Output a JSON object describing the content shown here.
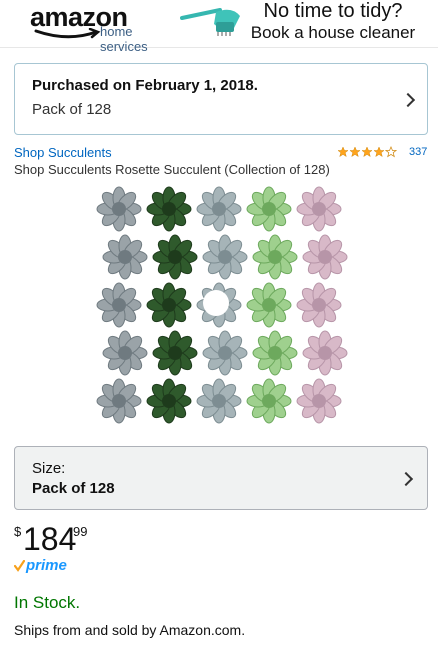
{
  "banner": {
    "logo_word": "amazon",
    "logo_sub": "home services",
    "tagline_line1": "No time to tidy?",
    "tagline_line2": "Book a house cleaner"
  },
  "purchase": {
    "title": "Purchased on February 1, 2018.",
    "variant": "Pack of 128"
  },
  "product": {
    "store_link": "Shop Succulents",
    "title": "Shop Succulents Rosette Succulent (Collection of 128)",
    "rating_stars": 4,
    "review_count": "337",
    "image_icon": "succulent-grid-photo"
  },
  "size": {
    "label": "Size:",
    "value": "Pack of 128"
  },
  "price": {
    "currency": "$",
    "whole": "184",
    "fraction": "99"
  },
  "prime": {
    "label": "prime"
  },
  "availability": {
    "stock": "In Stock.",
    "ships": "Ships from and sold by Amazon.com."
  },
  "colors": {
    "link": "#0066c0",
    "stock_green": "#007600",
    "prime_blue": "#1a98ff",
    "star": "#ffa41c",
    "card_border": "#a7c6d3"
  }
}
